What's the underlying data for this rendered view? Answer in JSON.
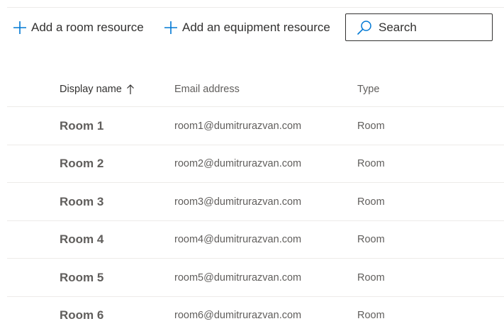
{
  "command_bar": {
    "add_room_label": "Add a room resource",
    "add_equipment_label": "Add an equipment resource",
    "search": {
      "placeholder": "Search",
      "value": ""
    },
    "icons": {
      "add": "plus-icon",
      "search": "search-icon"
    },
    "accent_color": "#0078d4"
  },
  "table": {
    "columns": {
      "display_name": "Display name",
      "email": "Email address",
      "type": "Type"
    },
    "sort": {
      "column": "display_name",
      "direction": "ascending",
      "icon": "arrow-up-icon"
    },
    "rows": [
      {
        "name": "Room 1",
        "email": "room1@dumitrurazvan.com",
        "type": "Room"
      },
      {
        "name": "Room 2",
        "email": "room2@dumitrurazvan.com",
        "type": "Room"
      },
      {
        "name": "Room 3",
        "email": "room3@dumitrurazvan.com",
        "type": "Room"
      },
      {
        "name": "Room 4",
        "email": "room4@dumitrurazvan.com",
        "type": "Room"
      },
      {
        "name": "Room 5",
        "email": "room5@dumitrurazvan.com",
        "type": "Room"
      },
      {
        "name": "Room 6",
        "email": "room6@dumitrurazvan.com",
        "type": "Room"
      }
    ]
  }
}
